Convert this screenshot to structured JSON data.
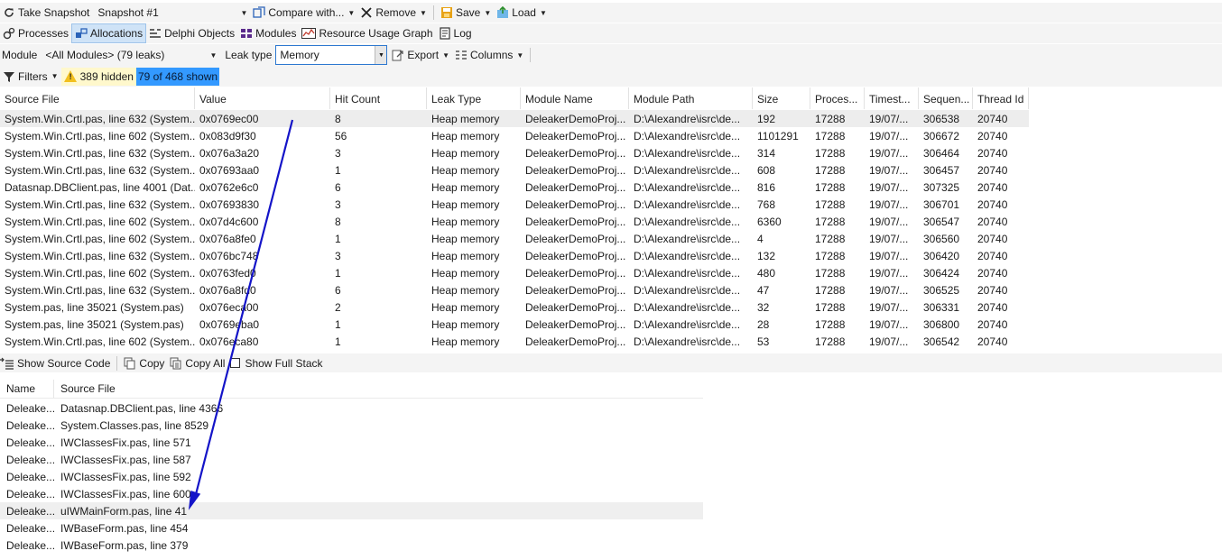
{
  "toolbar1": {
    "take_snapshot": "Take Snapshot",
    "snapshot_value": "Snapshot #1",
    "compare": "Compare with...",
    "remove": "Remove",
    "save": "Save",
    "load": "Load"
  },
  "tabs": [
    {
      "label": "Processes",
      "icon": "processes-icon"
    },
    {
      "label": "Allocations",
      "icon": "allocations-icon",
      "selected": true
    },
    {
      "label": "Delphi Objects",
      "icon": "delphi-objects-icon"
    },
    {
      "label": "Modules",
      "icon": "modules-icon"
    },
    {
      "label": "Resource Usage Graph",
      "icon": "graph-icon"
    },
    {
      "label": "Log",
      "icon": "log-icon"
    }
  ],
  "filterbar": {
    "module_label": "Module",
    "module_value": "<All Modules> (79 leaks)",
    "leak_type_label": "Leak type",
    "leak_type_value": "Memory",
    "export": "Export",
    "columns": "Columns"
  },
  "statusbar": {
    "filters": "Filters",
    "hidden": "389 hidden",
    "shown": "79 of 468 shown"
  },
  "colors": {
    "accent": "#3399ff",
    "warning": "#f2c01e",
    "arrow": "#1414c8"
  },
  "grid": {
    "columns": [
      "Source File",
      "Value",
      "Hit Count",
      "Leak Type",
      "Module Name",
      "Module Path",
      "Size",
      "Proces...",
      "Timest...",
      "Sequen...",
      "Thread Id"
    ],
    "rows": [
      [
        "System.Win.Crtl.pas, line 632 (System....",
        "0x0769ec00",
        "8",
        "Heap memory",
        "DeleakerDemoProj...",
        "D:\\Alexandre\\isrc\\de...",
        "192",
        "17288",
        "19/07/...",
        "306538",
        "20740"
      ],
      [
        "System.Win.Crtl.pas, line 602 (System....",
        "0x083d9f30",
        "56",
        "Heap memory",
        "DeleakerDemoProj...",
        "D:\\Alexandre\\isrc\\de...",
        "1101291",
        "17288",
        "19/07/...",
        "306672",
        "20740"
      ],
      [
        "System.Win.Crtl.pas, line 632 (System....",
        "0x076a3a20",
        "3",
        "Heap memory",
        "DeleakerDemoProj...",
        "D:\\Alexandre\\isrc\\de...",
        "314",
        "17288",
        "19/07/...",
        "306464",
        "20740"
      ],
      [
        "System.Win.Crtl.pas, line 632 (System....",
        "0x07693aa0",
        "1",
        "Heap memory",
        "DeleakerDemoProj...",
        "D:\\Alexandre\\isrc\\de...",
        "608",
        "17288",
        "19/07/...",
        "306457",
        "20740"
      ],
      [
        "Datasnap.DBClient.pas, line 4001 (Dat...",
        "0x0762e6c0",
        "6",
        "Heap memory",
        "DeleakerDemoProj...",
        "D:\\Alexandre\\isrc\\de...",
        "816",
        "17288",
        "19/07/...",
        "307325",
        "20740"
      ],
      [
        "System.Win.Crtl.pas, line 632 (System....",
        "0x07693830",
        "3",
        "Heap memory",
        "DeleakerDemoProj...",
        "D:\\Alexandre\\isrc\\de...",
        "768",
        "17288",
        "19/07/...",
        "306701",
        "20740"
      ],
      [
        "System.Win.Crtl.pas, line 602 (System....",
        "0x07d4c600",
        "8",
        "Heap memory",
        "DeleakerDemoProj...",
        "D:\\Alexandre\\isrc\\de...",
        "6360",
        "17288",
        "19/07/...",
        "306547",
        "20740"
      ],
      [
        "System.Win.Crtl.pas, line 602 (System....",
        "0x076a8fe0",
        "1",
        "Heap memory",
        "DeleakerDemoProj...",
        "D:\\Alexandre\\isrc\\de...",
        "4",
        "17288",
        "19/07/...",
        "306560",
        "20740"
      ],
      [
        "System.Win.Crtl.pas, line 632 (System....",
        "0x076bc748",
        "3",
        "Heap memory",
        "DeleakerDemoProj...",
        "D:\\Alexandre\\isrc\\de...",
        "132",
        "17288",
        "19/07/...",
        "306420",
        "20740"
      ],
      [
        "System.Win.Crtl.pas, line 602 (System....",
        "0x0763fed0",
        "1",
        "Heap memory",
        "DeleakerDemoProj...",
        "D:\\Alexandre\\isrc\\de...",
        "480",
        "17288",
        "19/07/...",
        "306424",
        "20740"
      ],
      [
        "System.Win.Crtl.pas, line 632 (System....",
        "0x076a8fd0",
        "6",
        "Heap memory",
        "DeleakerDemoProj...",
        "D:\\Alexandre\\isrc\\de...",
        "47",
        "17288",
        "19/07/...",
        "306525",
        "20740"
      ],
      [
        "System.pas, line 35021 (System.pas)",
        "0x076eca00",
        "2",
        "Heap memory",
        "DeleakerDemoProj...",
        "D:\\Alexandre\\isrc\\de...",
        "32",
        "17288",
        "19/07/...",
        "306331",
        "20740"
      ],
      [
        "System.pas, line 35021 (System.pas)",
        "0x0769eba0",
        "1",
        "Heap memory",
        "DeleakerDemoProj...",
        "D:\\Alexandre\\isrc\\de...",
        "28",
        "17288",
        "19/07/...",
        "306800",
        "20740"
      ],
      [
        "System.Win.Crtl.pas, line 602 (System....",
        "0x076eca80",
        "1",
        "Heap memory",
        "DeleakerDemoProj...",
        "D:\\Alexandre\\isrc\\de...",
        "53",
        "17288",
        "19/07/...",
        "306542",
        "20740"
      ]
    ]
  },
  "stackbar": {
    "show_source": "Show Source Code",
    "copy": "Copy",
    "copy_all": "Copy All",
    "show_full_stack": "Show Full Stack"
  },
  "stack": {
    "columns": [
      "Name",
      "Source File"
    ],
    "rows": [
      [
        "Deleake...",
        "Datasnap.DBClient.pas, line 4366"
      ],
      [
        "Deleake...",
        "System.Classes.pas, line 8529"
      ],
      [
        "Deleake...",
        "IWClassesFix.pas, line 571"
      ],
      [
        "Deleake...",
        "IWClassesFix.pas, line 587"
      ],
      [
        "Deleake...",
        "IWClassesFix.pas, line 592"
      ],
      [
        "Deleake...",
        "IWClassesFix.pas, line 600"
      ],
      [
        "Deleake...",
        "uIWMainForm.pas, line 41"
      ],
      [
        "Deleake...",
        "IWBaseForm.pas, line 454"
      ],
      [
        "Deleake...",
        "IWBaseForm.pas, line 379"
      ]
    ]
  }
}
